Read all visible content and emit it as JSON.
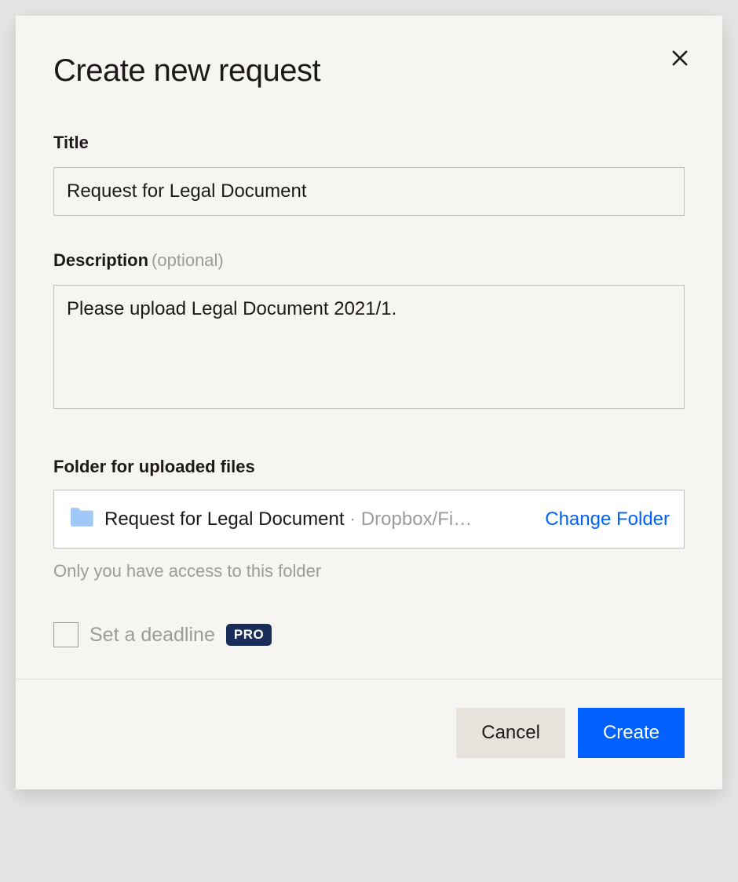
{
  "modal": {
    "title": "Create new request",
    "title_field": {
      "label": "Title",
      "value": "Request for Legal Document"
    },
    "description_field": {
      "label": "Description",
      "suffix": "(optional)",
      "value": "Please upload Legal Document 2021/1."
    },
    "folder_field": {
      "label": "Folder for uploaded files",
      "folder_name": "Request for Legal Document",
      "folder_path": " · Dropbox/Fi…",
      "change_label": "Change Folder",
      "helper": "Only you have access to this folder"
    },
    "deadline": {
      "label": "Set a deadline",
      "badge": "PRO"
    },
    "footer": {
      "cancel": "Cancel",
      "create": "Create"
    }
  }
}
